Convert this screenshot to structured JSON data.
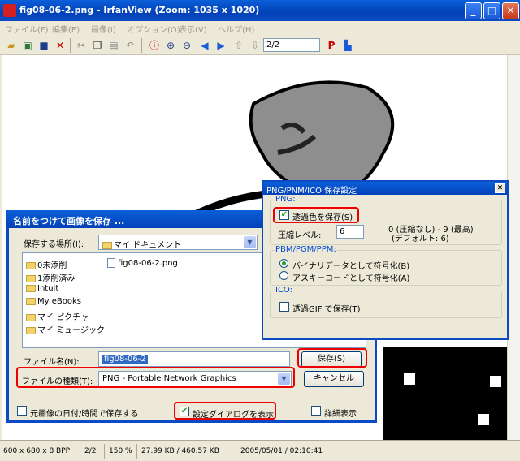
{
  "app": {
    "title": "fig08-06-2.png - IrfanView (Zoom: 1035 x 1020)",
    "window_buttons": {
      "minimize": "_",
      "maximize": "□",
      "close": "✕"
    }
  },
  "menu": [
    "ファイル(F)",
    "編集(E)",
    "画像(I)",
    "オプション(O)",
    "表示(V)",
    "ヘルプ(H)"
  ],
  "toolbar": {
    "page": "2/2"
  },
  "status": {
    "dimensions": "600 x 680 x 8 BPP",
    "page": "2/2",
    "zoom": "150 %",
    "size": "27.99 KB / 460.57 KB",
    "datetime": "2005/05/01 / 02:10:41"
  },
  "save_dialog": {
    "title": "名前をつけて画像を保存 ...",
    "location_label": "保存する場所(I):",
    "location_value": "マイ ドキュメント",
    "items": [
      {
        "name": "0未添削",
        "type": "folder"
      },
      {
        "name": "1添削済み",
        "type": "folder"
      },
      {
        "name": "Intuit",
        "type": "folder"
      },
      {
        "name": "My eBooks",
        "type": "folder"
      },
      {
        "name": "マイ ピクチャ",
        "type": "folder"
      },
      {
        "name": "マイ ミュージック",
        "type": "folder"
      },
      {
        "name": "fig08-06-2.png",
        "type": "file"
      }
    ],
    "filename_label": "ファイル名(N):",
    "filename_value": "fig08-06-2",
    "filetype_label": "ファイルの種類(T):",
    "filetype_value": "PNG - Portable Network Graphics",
    "save_button": "保存(S)",
    "cancel_button": "キャンセル",
    "keep_date_label": "元画像の日付/時間で保存する",
    "show_settings_label": "設定ダイアログを表示",
    "detail_label": "詳細表示"
  },
  "png_dialog": {
    "title": "PNG/PNM/ICO 保存設定",
    "close": "✕",
    "png_group": "PNG:",
    "transparent_label": "透過色を保存(S)",
    "compression_label": "圧縮レベル:",
    "compression_value": "6",
    "compression_hint1": "0 (圧縮なし) - 9 (最高)",
    "compression_hint2": "(デフォルト: 6)",
    "pbm_group": "PBM/PGM/PPM:",
    "binary_label": "バイナリデータとして符号化(B)",
    "ascii_label": "アスキーコードとして符号化(A)",
    "ico_group": "ICO:",
    "ico_gif_label": "透過GIF で保存(T)"
  }
}
